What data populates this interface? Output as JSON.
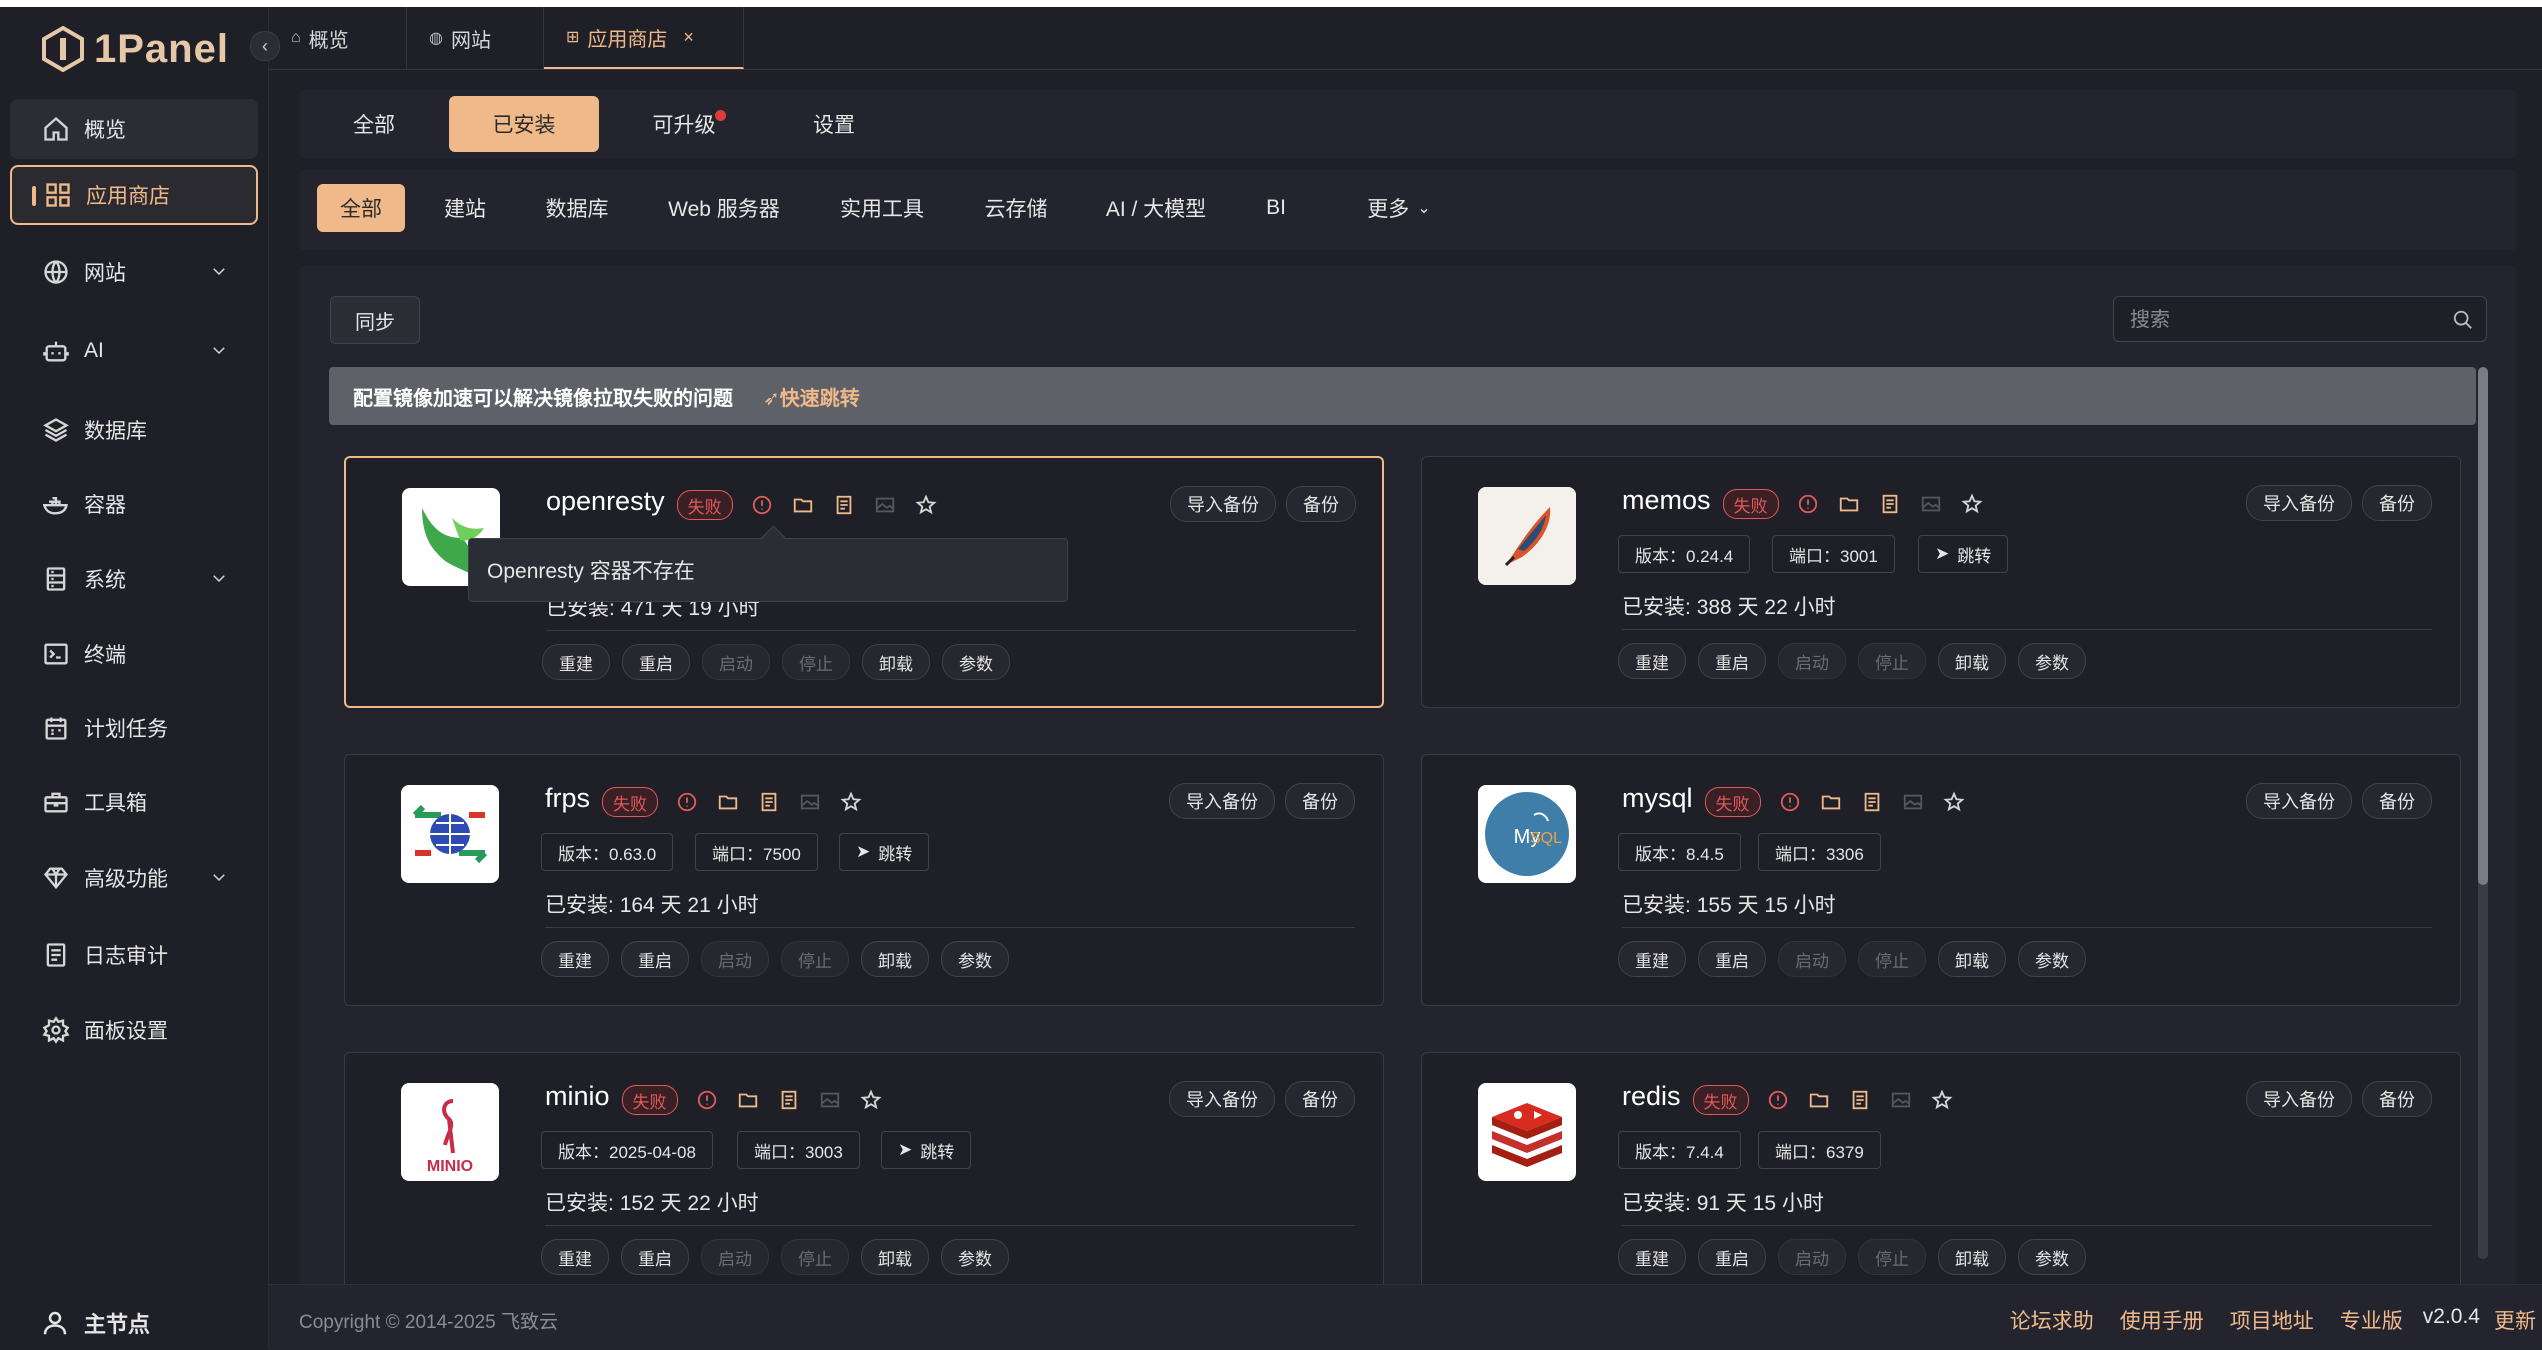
{
  "app": {
    "logo_text": "1Panel"
  },
  "sidebar": {
    "items": [
      {
        "label": "概览"
      },
      {
        "label": "应用商店"
      },
      {
        "label": "网站"
      },
      {
        "label": "AI"
      },
      {
        "label": "数据库"
      },
      {
        "label": "容器"
      },
      {
        "label": "系统"
      },
      {
        "label": "终端"
      },
      {
        "label": "计划任务"
      },
      {
        "label": "工具箱"
      },
      {
        "label": "高级功能"
      },
      {
        "label": "日志审计"
      },
      {
        "label": "面板设置"
      }
    ],
    "user": "主节点"
  },
  "tabs": [
    {
      "label": "概览"
    },
    {
      "label": "网站"
    },
    {
      "label": "应用商店"
    }
  ],
  "top_filter": {
    "all": "全部",
    "installed": "已安装",
    "upgradable": "可升级",
    "settings": "设置"
  },
  "categories": [
    "全部",
    "建站",
    "数据库",
    "Web 服务器",
    "实用工具",
    "云存储",
    "AI / 大模型",
    "BI",
    "更多"
  ],
  "toolbar": {
    "sync": "同步",
    "search_placeholder": "搜索"
  },
  "banner": {
    "message": "配置镜像加速可以解决镜像拉取失败的问题",
    "link": "快速跳转"
  },
  "card_labels": {
    "status": "失败",
    "import_backup": "导入备份",
    "backup": "备份",
    "jump": "跳转",
    "installed_prefix": "已安装:",
    "actions": [
      "重建",
      "重启",
      "启动",
      "停止",
      "卸载",
      "参数"
    ]
  },
  "apps": [
    {
      "name": "openresty",
      "installed": "471 天 19 小时"
    },
    {
      "name": "memos",
      "version": "版本：0.24.4",
      "port": "端口：3001",
      "installed": "388 天 22 小时"
    },
    {
      "name": "frps",
      "version": "版本：0.63.0",
      "port": "端口：7500",
      "installed": "164 天 21 小时"
    },
    {
      "name": "mysql",
      "version": "版本：8.4.5",
      "port": "端口：3306",
      "installed": "155 天 15 小时"
    },
    {
      "name": "minio",
      "version": "版本：2025-04-08",
      "port": "端口：3003",
      "installed": "152 天 22 小时"
    },
    {
      "name": "redis",
      "version": "版本：7.4.4",
      "port": "端口：6379",
      "installed": "91 天 15 小时"
    }
  ],
  "tooltip": "Openresty 容器不存在",
  "footer": {
    "copyright": "Copyright © 2014-2025 飞致云",
    "links": [
      "论坛求助",
      "使用手册",
      "项目地址",
      "专业版"
    ],
    "version": "v2.0.4",
    "update": "更新"
  },
  "colors": {
    "accent": "#f0b98a",
    "background": "#1e1f27",
    "panel": "#23242d",
    "danger": "#e05a5a",
    "icon_open": "#f0b98a"
  }
}
